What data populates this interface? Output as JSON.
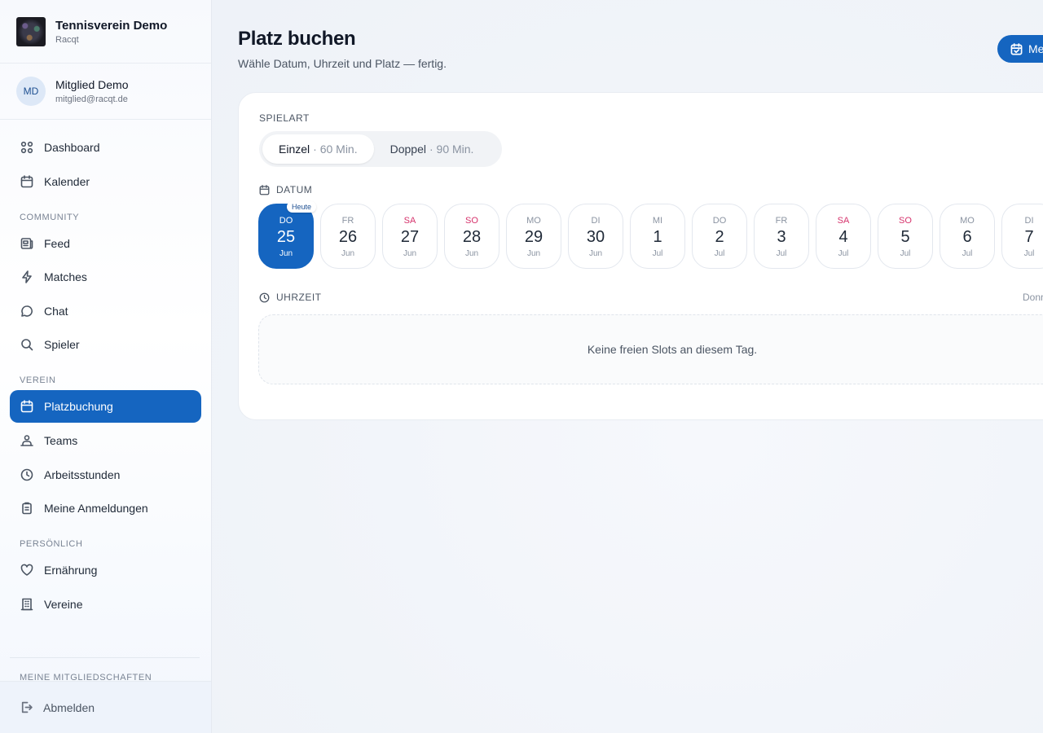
{
  "brand": {
    "title": "Tennisverein Demo",
    "subtitle": "Racqt"
  },
  "user": {
    "initials": "MD",
    "name": "Mitglied Demo",
    "email": "mitglied@racqt.de"
  },
  "nav": {
    "main": [
      {
        "label": "Dashboard",
        "icon": "dashboard-icon"
      },
      {
        "label": "Kalender",
        "icon": "calendar-icon"
      }
    ],
    "community_label": "COMMUNITY",
    "community": [
      {
        "label": "Feed",
        "icon": "newspaper-icon"
      },
      {
        "label": "Matches",
        "icon": "lightning-icon"
      },
      {
        "label": "Chat",
        "icon": "chat-bubble-icon"
      },
      {
        "label": "Spieler",
        "icon": "search-icon"
      }
    ],
    "verein_label": "VEREIN",
    "verein": [
      {
        "label": "Platzbuchung",
        "icon": "calendar-check-icon",
        "active": true
      },
      {
        "label": "Teams",
        "icon": "people-icon"
      },
      {
        "label": "Arbeitsstunden",
        "icon": "clock-icon"
      },
      {
        "label": "Meine Anmeldungen",
        "icon": "clipboard-icon"
      }
    ],
    "persoenlich_label": "PERSÖNLICH",
    "persoenlich": [
      {
        "label": "Ernährung",
        "icon": "heart-icon"
      },
      {
        "label": "Vereine",
        "icon": "building-icon"
      }
    ],
    "memberships_label": "MEINE MITGLIEDSCHAFTEN",
    "logout": "Abmelden"
  },
  "page": {
    "title": "Platz buchen",
    "subtitle": "Wähle Datum, Uhrzeit und Platz — fertig.",
    "top_button": "Me"
  },
  "booking": {
    "spielart_label": "SPIELART",
    "options": [
      {
        "label": "Einzel",
        "duration": "· 60 Min.",
        "active": true
      },
      {
        "label": "Doppel",
        "duration": "· 90 Min.",
        "active": false
      }
    ],
    "datum_label": "DATUM",
    "today_badge": "Heute",
    "dates": [
      {
        "dow": "DO",
        "day": "25",
        "month": "Jun",
        "active": true,
        "weekend": false
      },
      {
        "dow": "FR",
        "day": "26",
        "month": "Jun",
        "weekend": false
      },
      {
        "dow": "SA",
        "day": "27",
        "month": "Jun",
        "weekend": true
      },
      {
        "dow": "SO",
        "day": "28",
        "month": "Jun",
        "weekend": true
      },
      {
        "dow": "MO",
        "day": "29",
        "month": "Jun",
        "weekend": false
      },
      {
        "dow": "DI",
        "day": "30",
        "month": "Jun",
        "weekend": false
      },
      {
        "dow": "MI",
        "day": "1",
        "month": "Jul",
        "weekend": false
      },
      {
        "dow": "DO",
        "day": "2",
        "month": "Jul",
        "weekend": false
      },
      {
        "dow": "FR",
        "day": "3",
        "month": "Jul",
        "weekend": false
      },
      {
        "dow": "SA",
        "day": "4",
        "month": "Jul",
        "weekend": true
      },
      {
        "dow": "SO",
        "day": "5",
        "month": "Jul",
        "weekend": true
      },
      {
        "dow": "MO",
        "day": "6",
        "month": "Jul",
        "weekend": false
      },
      {
        "dow": "DI",
        "day": "7",
        "month": "Jul",
        "weekend": false
      }
    ],
    "uhrzeit_label": "UHRZEIT",
    "uhrzeit_hint": "Donn",
    "empty_message": "Keine freien Slots an diesem Tag."
  },
  "colors": {
    "primary": "#1565c0",
    "weekend": "#d6336c"
  }
}
